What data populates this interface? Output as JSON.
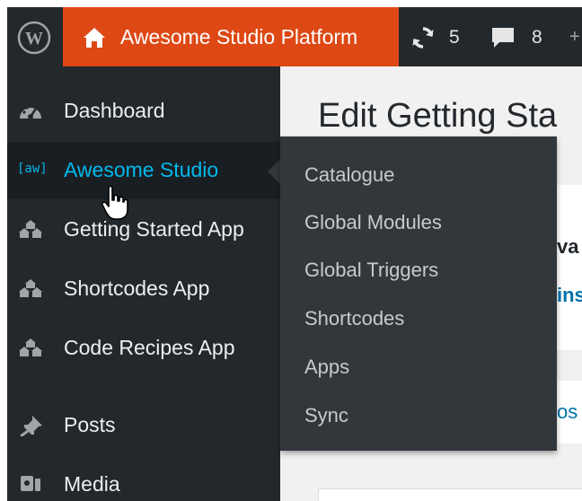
{
  "admin_bar": {
    "site_name": "Awesome Studio Platform",
    "updates_count": "5",
    "comments_count": "8",
    "more": "+"
  },
  "sidebar": {
    "items": [
      {
        "label": "Dashboard",
        "icon": "dashboard-icon"
      },
      {
        "label": "Awesome Studio",
        "icon": "awesome-studio-icon",
        "icon_text": "[aw]",
        "active": true
      },
      {
        "label": "Getting Started App",
        "icon": "app-stack-icon"
      },
      {
        "label": "Shortcodes App",
        "icon": "app-stack-icon"
      },
      {
        "label": "Code Recipes App",
        "icon": "app-stack-icon"
      },
      {
        "label": "Posts",
        "icon": "pin-icon"
      },
      {
        "label": "Media",
        "icon": "media-icon"
      }
    ]
  },
  "submenu": {
    "items": [
      "Catalogue",
      "Global Modules",
      "Global Triggers",
      "Shortcodes",
      "Apps",
      "Sync"
    ]
  },
  "content": {
    "page_title": "Edit Getting Sta",
    "card1_text_a": "va",
    "card1_text_b": "ins",
    "card2_text": "os"
  },
  "colors": {
    "admin_bar": "#23282d",
    "site_item": "#dd4814",
    "sidebar": "#23282d",
    "active_item": "#191e23",
    "accent": "#00b9eb",
    "flyout": "#32373c"
  }
}
